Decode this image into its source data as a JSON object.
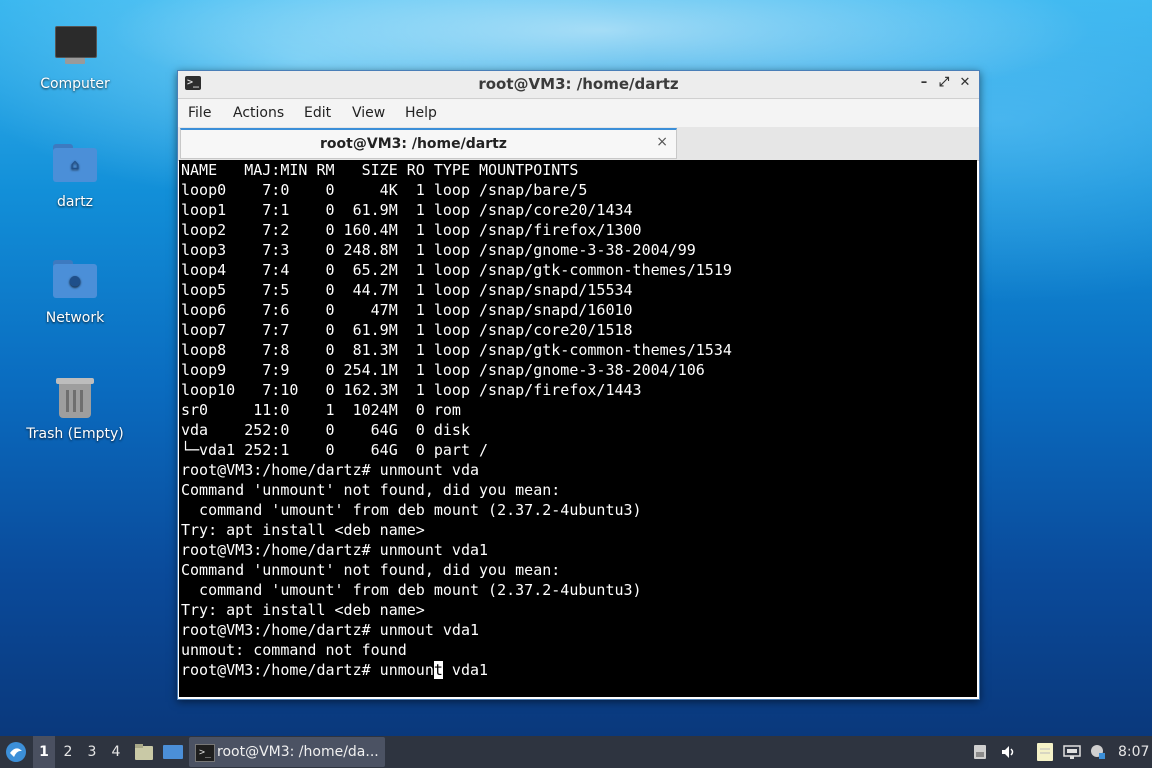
{
  "desktop": {
    "icons": [
      {
        "label": "Computer"
      },
      {
        "label": "dartz"
      },
      {
        "label": "Network"
      },
      {
        "label": "Trash (Empty)"
      }
    ]
  },
  "window": {
    "title": "root@VM3: /home/dartz",
    "controls": {
      "minimize": "–",
      "maximize": "⤢",
      "close": "✕"
    },
    "menu": [
      "File",
      "Actions",
      "Edit",
      "View",
      "Help"
    ],
    "tab": {
      "title": "root@VM3: /home/dartz",
      "close": "×"
    }
  },
  "terminal": {
    "lines": [
      "NAME   MAJ:MIN RM   SIZE RO TYPE MOUNTPOINTS",
      "loop0    7:0    0     4K  1 loop /snap/bare/5",
      "loop1    7:1    0  61.9M  1 loop /snap/core20/1434",
      "loop2    7:2    0 160.4M  1 loop /snap/firefox/1300",
      "loop3    7:3    0 248.8M  1 loop /snap/gnome-3-38-2004/99",
      "loop4    7:4    0  65.2M  1 loop /snap/gtk-common-themes/1519",
      "loop5    7:5    0  44.7M  1 loop /snap/snapd/15534",
      "loop6    7:6    0    47M  1 loop /snap/snapd/16010",
      "loop7    7:7    0  61.9M  1 loop /snap/core20/1518",
      "loop8    7:8    0  81.3M  1 loop /snap/gtk-common-themes/1534",
      "loop9    7:9    0 254.1M  1 loop /snap/gnome-3-38-2004/106",
      "loop10   7:10   0 162.3M  1 loop /snap/firefox/1443",
      "sr0     11:0    1  1024M  0 rom",
      "vda    252:0    0    64G  0 disk",
      "└─vda1 252:1    0    64G  0 part /",
      "root@VM3:/home/dartz# unmount vda",
      "Command 'unmount' not found, did you mean:",
      "  command 'umount' from deb mount (2.37.2-4ubuntu3)",
      "Try: apt install <deb name>",
      "root@VM3:/home/dartz# unmount vda1",
      "Command 'unmount' not found, did you mean:",
      "  command 'umount' from deb mount (2.37.2-4ubuntu3)",
      "Try: apt install <deb name>",
      "root@VM3:/home/dartz# unmout vda1",
      "unmout: command not found"
    ],
    "prompt_line": {
      "before_cursor": "root@VM3:/home/dartz# unmoun",
      "cursor_char": "t",
      "after_cursor": " vda1"
    }
  },
  "taskbar": {
    "workspaces": [
      "1",
      "2",
      "3",
      "4"
    ],
    "active_workspace": "1",
    "task": {
      "label": "root@VM3: /home/da..."
    },
    "clock": "8:07",
    "colors": {
      "bar": "#2e3440",
      "accent": "#3c8fd8"
    }
  }
}
